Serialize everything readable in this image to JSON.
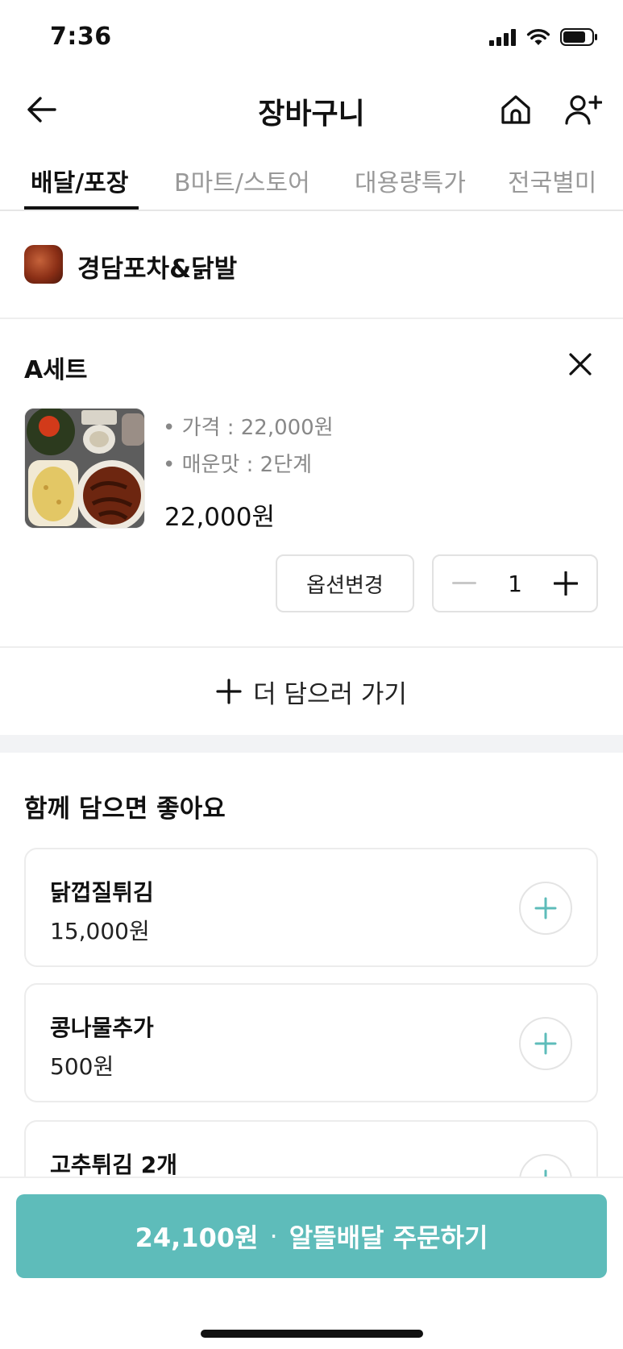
{
  "status_bar": {
    "time": "7:36"
  },
  "header": {
    "title": "장바구니"
  },
  "tabs": [
    {
      "label": "배달/포장",
      "active": true
    },
    {
      "label": "B마트/스토어",
      "active": false
    },
    {
      "label": "대용량특가",
      "active": false
    },
    {
      "label": "전국별미",
      "active": false
    }
  ],
  "store": {
    "name": "경담포차&닭발"
  },
  "cart_item": {
    "name": "A세트",
    "options": [
      "• 가격 : 22,000원",
      "• 매운맛 : 2단계"
    ],
    "price": "22,000원",
    "option_change_label": "옵션변경",
    "quantity": "1"
  },
  "add_more": {
    "label": "더 담으러 가기"
  },
  "recommendations": {
    "title": "함께 담으면 좋아요",
    "items": [
      {
        "name": "닭껍질튀김",
        "price": "15,000원"
      },
      {
        "name": "콩나물추가",
        "price": "500원"
      },
      {
        "name": "고추튀김 2개",
        "price": ""
      }
    ]
  },
  "order_button": {
    "total": "24,100원",
    "separator": "·",
    "label": "알뜰배달 주문하기"
  },
  "colors": {
    "accent": "#5ebcba",
    "text": "#111111",
    "muted": "#888888"
  }
}
